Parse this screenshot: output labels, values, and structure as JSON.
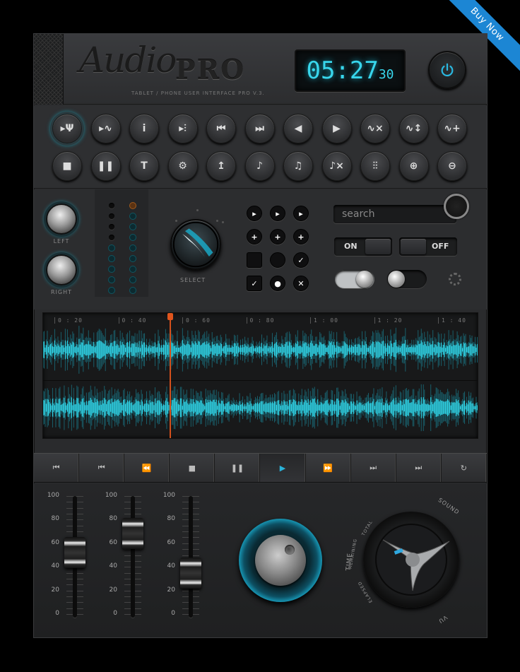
{
  "ribbon": {
    "label": "Buy Now"
  },
  "header": {
    "logo_script": "Audio",
    "logo_bold": "PRO",
    "subtitle": "TABLET / PHONE USER INTERFACE PRO V.3.",
    "timer_main": "05:27",
    "timer_sec": "30",
    "power_icon": "power-icon"
  },
  "buttons_row1": [
    {
      "icon": "mic-stand-icon",
      "glyph": "▸Ψ",
      "active": true
    },
    {
      "icon": "waveform-play-icon",
      "glyph": "▸∿"
    },
    {
      "icon": "info-icon",
      "glyph": "i"
    },
    {
      "icon": "play-levels-icon",
      "glyph": "▸⫶"
    },
    {
      "icon": "skip-back-icon",
      "glyph": "⏮"
    },
    {
      "icon": "skip-forward-icon",
      "glyph": "⏭"
    },
    {
      "icon": "rewind-icon",
      "glyph": "◀"
    },
    {
      "icon": "play-icon",
      "glyph": "▶"
    },
    {
      "icon": "waveform-x-icon",
      "glyph": "∿×"
    },
    {
      "icon": "waveform-updown-icon",
      "glyph": "∿↕"
    },
    {
      "icon": "waveform-plus-icon",
      "glyph": "∿+"
    }
  ],
  "buttons_row2": [
    {
      "icon": "stop-icon",
      "glyph": "■"
    },
    {
      "icon": "pause-icon",
      "glyph": "❚❚"
    },
    {
      "icon": "text-icon",
      "glyph": "T"
    },
    {
      "icon": "gear-icon",
      "glyph": "⚙"
    },
    {
      "icon": "upload-icon",
      "glyph": "↥"
    },
    {
      "icon": "music-note-icon",
      "glyph": "♪"
    },
    {
      "icon": "note-bar-icon",
      "glyph": "♫"
    },
    {
      "icon": "note-x-icon",
      "glyph": "♪×"
    },
    {
      "icon": "equalizer-icon",
      "glyph": "⫶⫶"
    },
    {
      "icon": "zoom-in-icon",
      "glyph": "⊕"
    },
    {
      "icon": "zoom-out-icon",
      "glyph": "⊖"
    }
  ],
  "knobs": {
    "left_label": "LEFT",
    "right_label": "RIGHT",
    "select_label": "SELECT"
  },
  "mini_buttons": [
    {
      "icon": "play-mini-icon",
      "glyph": "▸"
    },
    {
      "icon": "play-mini-icon",
      "glyph": "▸"
    },
    {
      "icon": "play-mini-icon",
      "glyph": "▸"
    },
    {
      "icon": "plus-mini-icon",
      "glyph": "+"
    },
    {
      "icon": "plus-mini-icon",
      "glyph": "+"
    },
    {
      "icon": "plus-mini-icon",
      "glyph": "+"
    },
    {
      "icon": "checkbox-empty-icon",
      "glyph": "",
      "square": true
    },
    {
      "icon": "radio-empty-icon",
      "glyph": ""
    },
    {
      "icon": "check-circle-icon",
      "glyph": "✓"
    },
    {
      "icon": "checkbox-checked-icon",
      "glyph": "✓",
      "square": true
    },
    {
      "icon": "radio-selected-icon",
      "glyph": "●"
    },
    {
      "icon": "close-circle-icon",
      "glyph": "✕"
    }
  ],
  "search": {
    "placeholder": "search"
  },
  "toggles": {
    "on_label": "ON",
    "off_label": "OFF"
  },
  "timeline": {
    "ticks": [
      "0 : 20",
      "0 : 40",
      "0 : 60",
      "0 : 80",
      "1 : 00",
      "1 : 20",
      "1 : 40"
    ],
    "accent": "#2fd3e6",
    "playhead_color": "#d4501c"
  },
  "transport": [
    {
      "icon": "skip-start-icon",
      "glyph": "⏮"
    },
    {
      "icon": "prev-track-icon",
      "glyph": "⏮"
    },
    {
      "icon": "rewind-icon",
      "glyph": "⏪"
    },
    {
      "icon": "stop-icon",
      "glyph": "■"
    },
    {
      "icon": "pause-icon",
      "glyph": "❚❚"
    },
    {
      "icon": "play-icon",
      "glyph": "▶",
      "active": true
    },
    {
      "icon": "fast-forward-icon",
      "glyph": "⏩"
    },
    {
      "icon": "next-track-icon",
      "glyph": "⏭"
    },
    {
      "icon": "skip-end-icon",
      "glyph": "⏭"
    },
    {
      "icon": "repeat-icon",
      "glyph": "↻"
    }
  ],
  "faders": {
    "scale": [
      "100",
      "80",
      "60",
      "40",
      "20",
      "0"
    ],
    "levels": [
      52,
      68,
      35
    ]
  },
  "mode_dial": {
    "sound": "SOUND",
    "total": "TOTAL",
    "time": "TIME",
    "remaining": "REMAINING",
    "elapsed": "ELAPSED",
    "vu": "VU"
  }
}
